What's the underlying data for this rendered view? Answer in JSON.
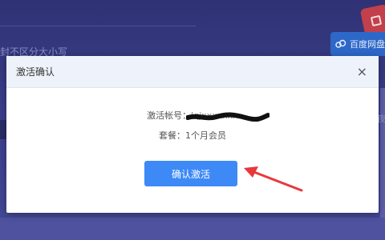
{
  "background": {
    "hint_text": "封不区分大小写",
    "brand_label": "百度网盘",
    "right_edge_text": "夜"
  },
  "modal": {
    "title": "激活确认",
    "close_symbol": "×",
    "account_label": "激活帐号：",
    "account_value": "lqjxxxxxxx",
    "plan_label": "套餐：",
    "plan_value": "1个月会员",
    "confirm_button": "确认激活"
  },
  "colors": {
    "overlay": "#3b3f86",
    "header_bg": "#eef3fb",
    "button": "#3d8af7",
    "arrow": "#e8383d"
  }
}
